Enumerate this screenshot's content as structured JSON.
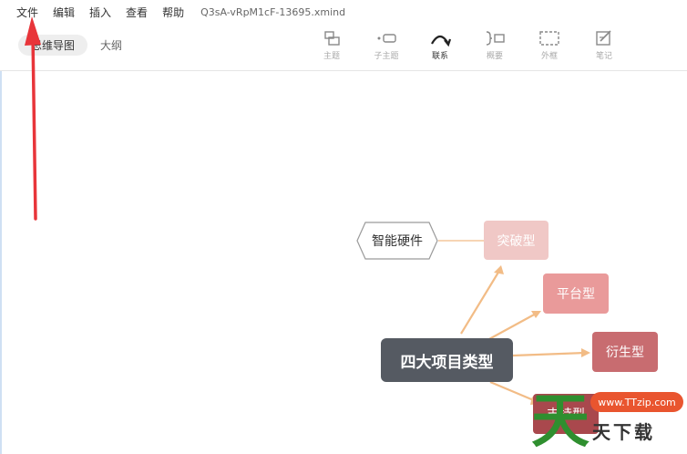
{
  "menu": {
    "items": [
      "文件",
      "编辑",
      "插入",
      "查看",
      "帮助"
    ],
    "filename": "Q3sA-vRpM1cF-13695.xmind"
  },
  "toolbar": {
    "tabs": {
      "mindmap": "思维导图",
      "outline": "大纲"
    },
    "tools": {
      "topic": "主题",
      "subtopic": "子主题",
      "relation": "联系",
      "summary": "概要",
      "boundary": "外框",
      "note": "笔记"
    }
  },
  "mindmap": {
    "central": "四大项目类型",
    "branches": [
      "突破型",
      "平台型",
      "衍生型",
      "支持型"
    ],
    "floating": "智能硬件",
    "colors": {
      "central": "#555a62",
      "branch1": "#f0c8c6",
      "branch2": "#e99a9a",
      "branch3": "#c86c70",
      "branch4": "#a9484d",
      "connector": "#f2bc86",
      "annotation_arrow": "#e8353a"
    }
  },
  "watermark": {
    "url": "www.TTzip.com",
    "glyph": "天",
    "text": "天下载"
  }
}
